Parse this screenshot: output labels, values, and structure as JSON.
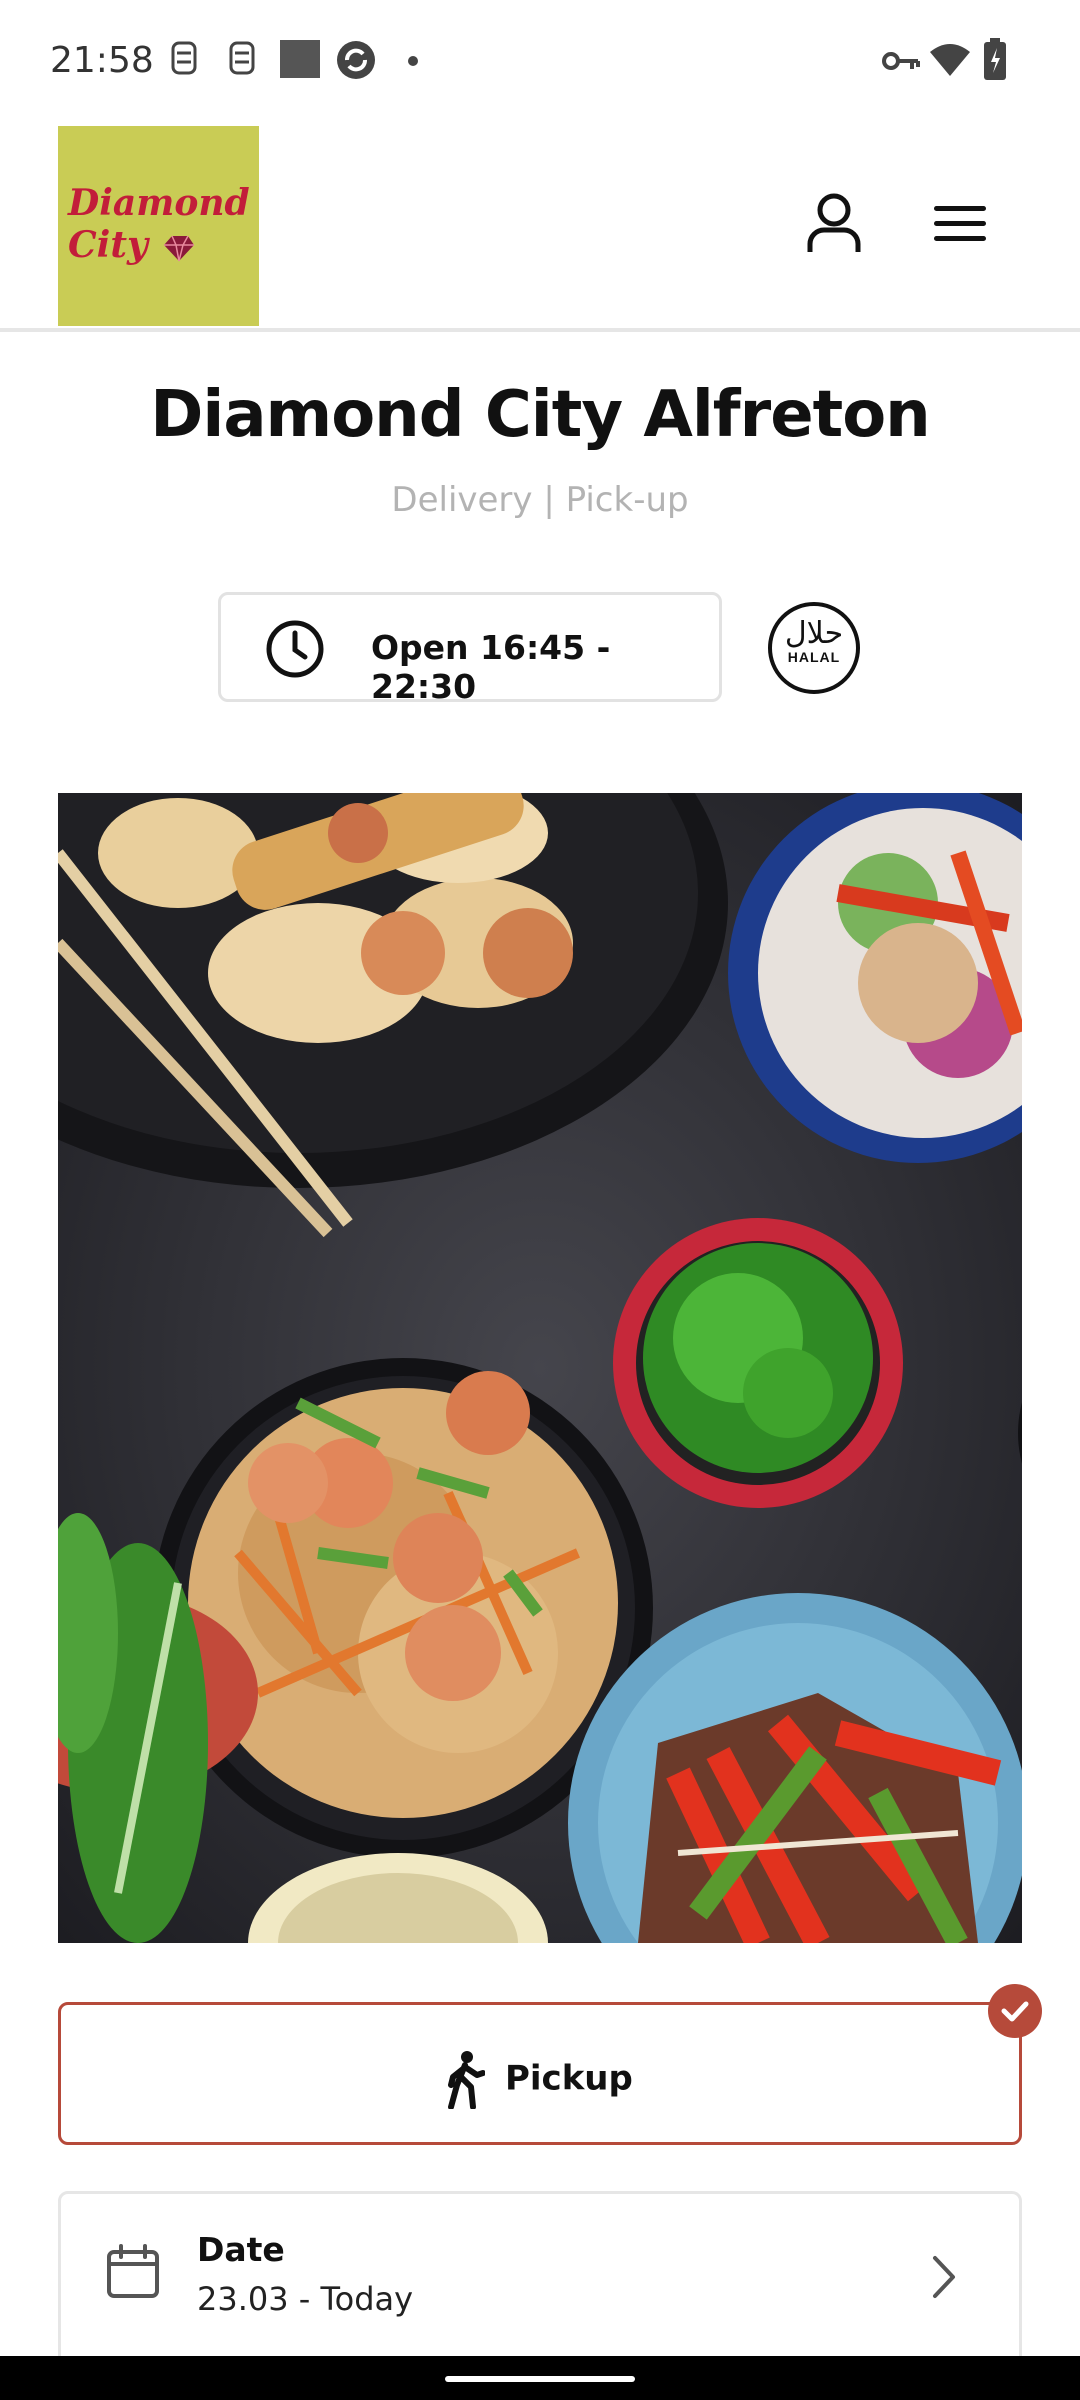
{
  "status_bar": {
    "time": "21:58",
    "icons": [
      "notification-icon",
      "notification-icon",
      "square-icon",
      "sync-icon",
      "dot-icon",
      "key-icon",
      "wifi-icon",
      "battery-icon"
    ]
  },
  "header": {
    "logo_line1": "Diamond",
    "logo_line2": "City",
    "logo_bg": "#c9cc55",
    "logo_color": "#c21d3a"
  },
  "restaurant": {
    "name": "Diamond City Alfreton",
    "services": "Delivery | Pick-up",
    "hours": "Open 16:45 - 22:30",
    "halal_ar": "حلال",
    "halal_en": "HALAL"
  },
  "order_mode": {
    "label": "Pickup",
    "selected": true,
    "accent": "#b64a3a"
  },
  "date": {
    "label": "Date",
    "value": "23.03 - Today"
  }
}
